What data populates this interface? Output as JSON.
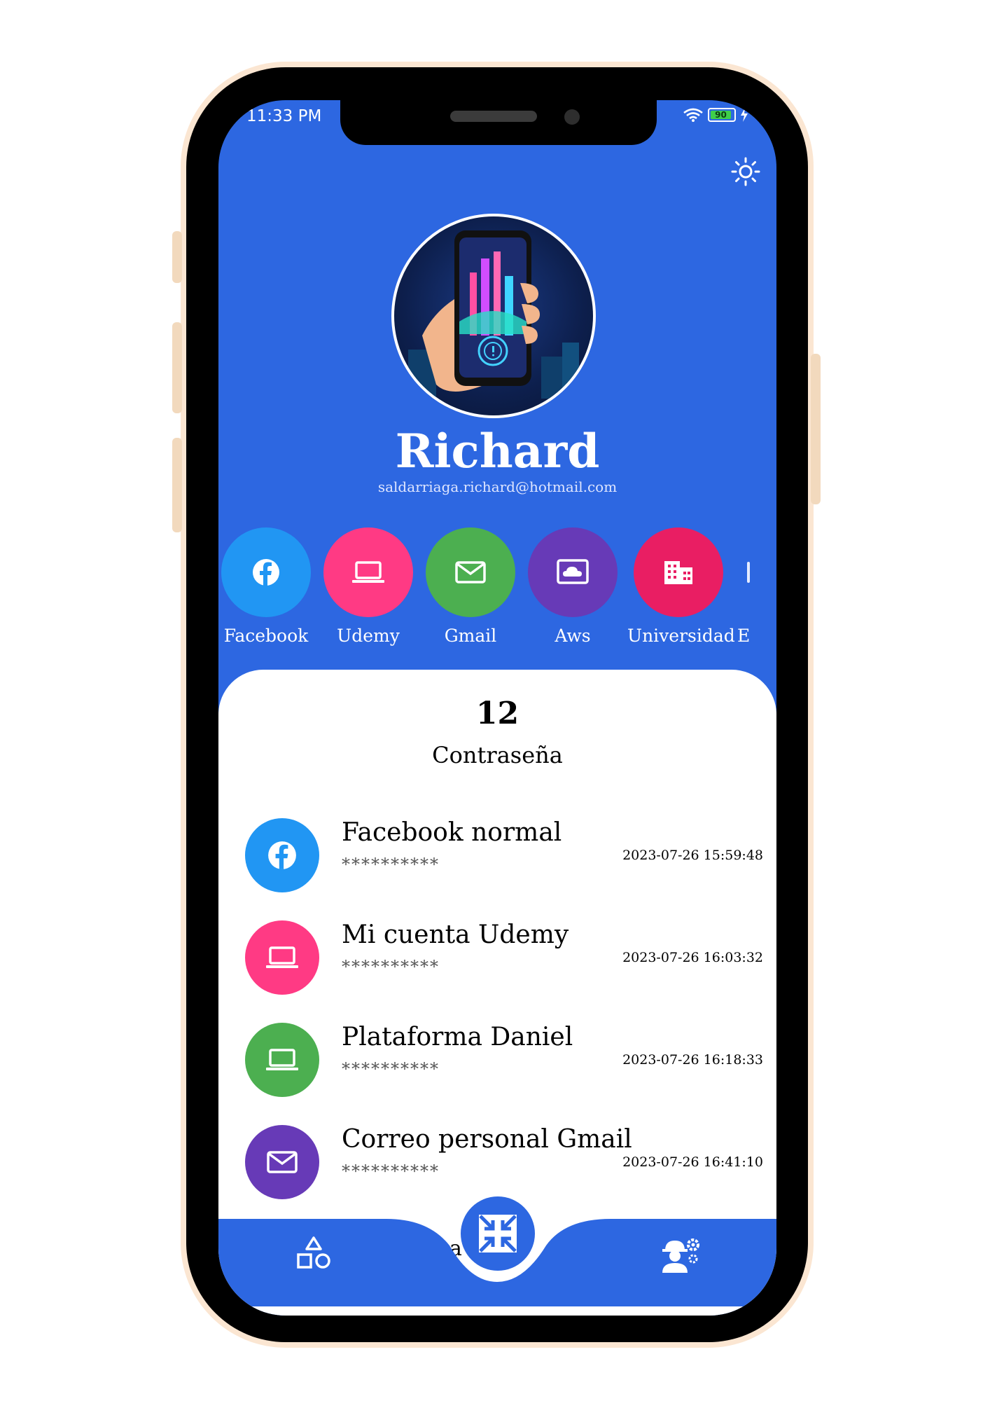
{
  "status_bar": {
    "time": "11:33 PM",
    "battery": "90"
  },
  "profile": {
    "name": "Richard",
    "email": "saldarriaga.richard@hotmail.com"
  },
  "categories": [
    {
      "label": "Facebook",
      "icon": "facebook-icon",
      "color": "#2196f3"
    },
    {
      "label": "Udemy",
      "icon": "laptop-icon",
      "color": "#ff3a84"
    },
    {
      "label": "Gmail",
      "icon": "mail-icon",
      "color": "#4caf50"
    },
    {
      "label": "Aws",
      "icon": "cloud-icon",
      "color": "#673ab7"
    },
    {
      "label": "Universidad",
      "icon": "building-icon",
      "color": "#e91e63"
    },
    {
      "label": "E"
    }
  ],
  "summary": {
    "count": "12",
    "label": "Contraseña"
  },
  "entries": [
    {
      "title": "Facebook normal",
      "password": "**********",
      "date": "2023-07-26 15:59:48",
      "icon": "facebook-icon",
      "color": "#2196f3"
    },
    {
      "title": "Mi cuenta Udemy",
      "password": "**********",
      "date": "2023-07-26 16:03:32",
      "icon": "laptop-icon",
      "color": "#ff3a84"
    },
    {
      "title": "Plataforma Daniel",
      "password": "**********",
      "date": "2023-07-26 16:18:33",
      "icon": "laptop-icon",
      "color": "#4caf50"
    },
    {
      "title": "Correo personal Gmail",
      "password": "**********",
      "date": "2023-07-26 16:41:10",
      "icon": "mail-icon",
      "color": "#673ab7"
    }
  ],
  "bottom_nav": {
    "partial_text": "a A"
  },
  "colors": {
    "primary": "#2d67e1"
  }
}
